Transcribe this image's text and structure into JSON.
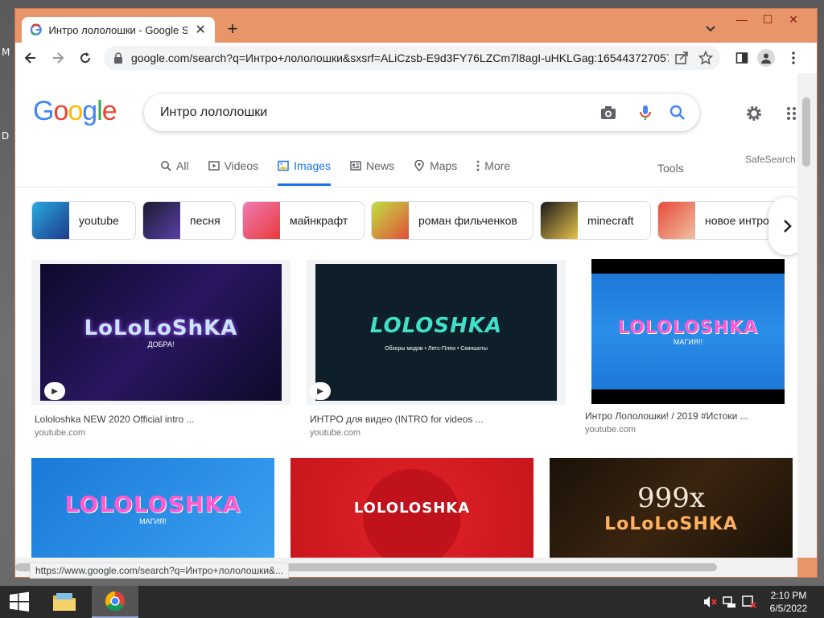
{
  "desktop": {
    "edge_letters": [
      "M",
      "D"
    ]
  },
  "browser": {
    "tab_title": "Интро лололошки - Google Sea",
    "new_tab": "+",
    "tab_close": "✕",
    "window_controls": {
      "minimize": "—",
      "maximize": "☐",
      "close": "✕"
    },
    "url": "google.com/search?q=Интро+лололошки&sxsrf=ALiCzsb-E9d3FY76LZCm7l8agI-uHKLGag:165443727057...",
    "status_url": "https://www.google.com/search?q=Интро+лололошки&..."
  },
  "google": {
    "logo_letters": [
      "G",
      "o",
      "o",
      "g",
      "l",
      "e"
    ],
    "logo_colors": [
      "#4285f4",
      "#ea4335",
      "#fbbc05",
      "#4285f4",
      "#34a853",
      "#ea4335"
    ],
    "query": "Интро лололошки",
    "tabs": [
      {
        "label": "All",
        "icon": "search-icon"
      },
      {
        "label": "Videos",
        "icon": "video-icon"
      },
      {
        "label": "Images",
        "icon": "image-icon",
        "active": true
      },
      {
        "label": "News",
        "icon": "news-icon"
      },
      {
        "label": "Maps",
        "icon": "map-pin-icon"
      },
      {
        "label": "More",
        "icon": "more-vertical-icon"
      }
    ],
    "tools": "Tools",
    "safesearch": "SafeSearch",
    "chips": [
      {
        "label": "youtube"
      },
      {
        "label": "песня"
      },
      {
        "label": "майнкрафт"
      },
      {
        "label": "роман фильченков"
      },
      {
        "label": "minecraft"
      },
      {
        "label": "новое интро"
      }
    ],
    "results": [
      {
        "caption": "Lololoshka NEW 2020 Official intro ...",
        "source": "youtube.com",
        "art_text": "LoLoLoShKA",
        "art_sub": "ДОБРА!"
      },
      {
        "caption": "ИНТРО для видео (INTRO for videos ...",
        "source": "youtube.com",
        "art_text": "LOLOSHKA",
        "art_sub": "Обзоры модов • Летс-Плеи • Скиншоты"
      },
      {
        "caption": "Интро Лололошки! / 2019 #Истоки ...",
        "source": "youtube.com",
        "art_text": "LOLOLOSHKA",
        "art_sub": "МАГИЯ!!"
      },
      {
        "caption": "",
        "source": "",
        "art_text": "LOLOLOSHKA",
        "art_sub": "МАГИЯ!"
      },
      {
        "caption": "",
        "source": "",
        "art_text": "LOLOLOSHKA",
        "art_sub": ""
      },
      {
        "caption": "",
        "source": "",
        "art_text": "LoLoLoSHKA",
        "art_sub": "999x"
      }
    ]
  },
  "taskbar": {
    "time": "2:10 PM",
    "date": "6/5/2022"
  }
}
